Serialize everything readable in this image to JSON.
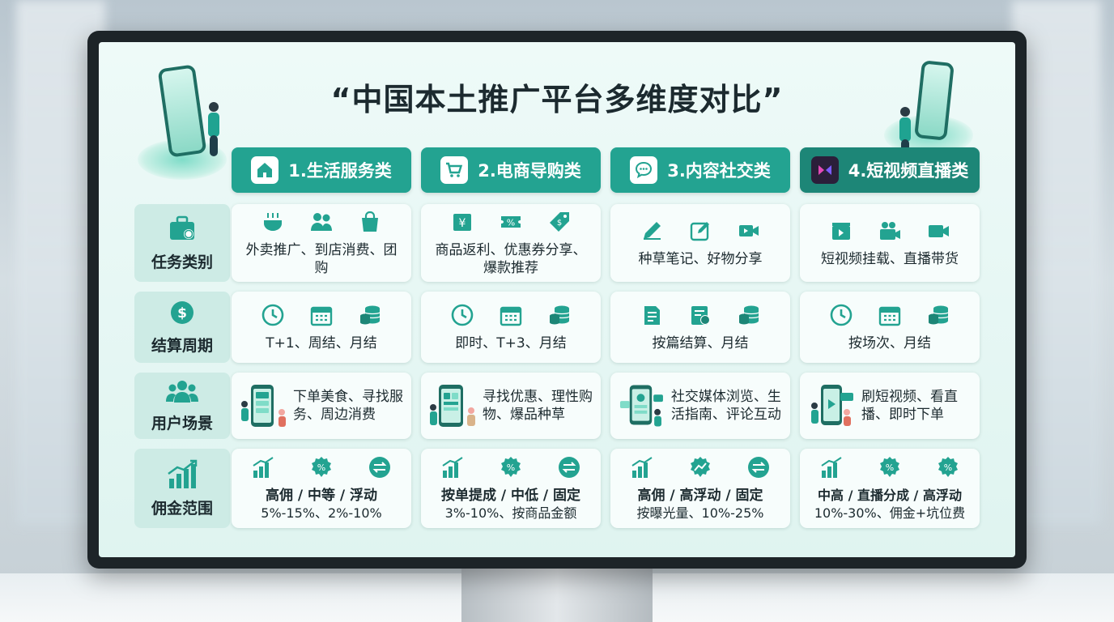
{
  "title": "“中国本土推广平台多维度对比”",
  "colors": {
    "accent": "#23a391",
    "accent_dark": "#1d8677",
    "screen_bg": "#e6f7f3",
    "label_bg": "#cdebe5"
  },
  "columns": [
    {
      "label": "1.生活服务类",
      "icon": "house-icon"
    },
    {
      "label": "2.电商导购类",
      "icon": "cart-icon"
    },
    {
      "label": "3.内容社交类",
      "icon": "chat-icon"
    },
    {
      "label": "4.短视频直播类",
      "icon": "video-play-icon"
    }
  ],
  "rows": [
    {
      "label": "任务类别",
      "icon": "briefcase-icon",
      "cells": [
        {
          "text": "外卖推广、到店消费、团购",
          "icons": [
            "food-bowl-icon",
            "people-icon",
            "shopping-bag-icon"
          ]
        },
        {
          "text": "商品返利、优惠券分享、爆款推荐",
          "icons": [
            "yuan-tag-icon",
            "coupon-icon",
            "price-tag-icon"
          ]
        },
        {
          "text": "种草笔记、好物分享",
          "icons": [
            "pencil-icon",
            "edit-icon",
            "video-camera-icon"
          ]
        },
        {
          "text": "短视频挂载、直播带货",
          "icons": [
            "clapper-icon",
            "film-camera-icon",
            "video-camera-icon"
          ]
        }
      ]
    },
    {
      "label": "结算周期",
      "icon": "dollar-circle-icon",
      "cells": [
        {
          "text": "T+1、周结、月结",
          "icons": [
            "clock-icon",
            "calendar-icon",
            "coins-icon"
          ]
        },
        {
          "text": "即时、T+3、月结",
          "icons": [
            "clock-icon",
            "calendar-icon",
            "coins-icon"
          ]
        },
        {
          "text": "按篇结算、月结",
          "icons": [
            "document-icon",
            "invoice-icon",
            "coins-icon"
          ]
        },
        {
          "text": "按场次、月结",
          "icons": [
            "clock-icon",
            "calendar-icon",
            "coins-icon"
          ]
        }
      ]
    },
    {
      "label": "用户场景",
      "icon": "users-icon",
      "cells": [
        {
          "text": "下单美食、寻找服务、周边消费"
        },
        {
          "text": "寻找优惠、理性购物、爆品种草"
        },
        {
          "text": "社交媒体浏览、生活指南、评论互动"
        },
        {
          "text": "刷短视频、看直播、即时下单"
        }
      ]
    },
    {
      "label": "佣金范围",
      "icon": "growth-chart-icon",
      "cells": [
        {
          "line1": "高佣 / 中等 / 浮动",
          "line2": "5%-15%、2%-10%",
          "icons": [
            "bar-chart-icon",
            "percent-icon",
            "swap-icon"
          ]
        },
        {
          "line1": "按单提成 / 中低 / 固定",
          "line2": "3%-10%、按商品金额",
          "icons": [
            "bar-chart-icon",
            "percent-icon",
            "swap-icon"
          ]
        },
        {
          "line1": "高佣 / 高浮动 / 固定",
          "line2": "按曝光量、10%-25%",
          "icons": [
            "bar-chart-icon",
            "trend-icon",
            "swap-icon"
          ]
        },
        {
          "line1": "中高 / 直播分成 / 高浮动",
          "line2": "10%-30%、佣金+坑位费",
          "icons": [
            "bar-chart-icon",
            "percent-icon",
            "percent-icon"
          ]
        }
      ]
    }
  ]
}
